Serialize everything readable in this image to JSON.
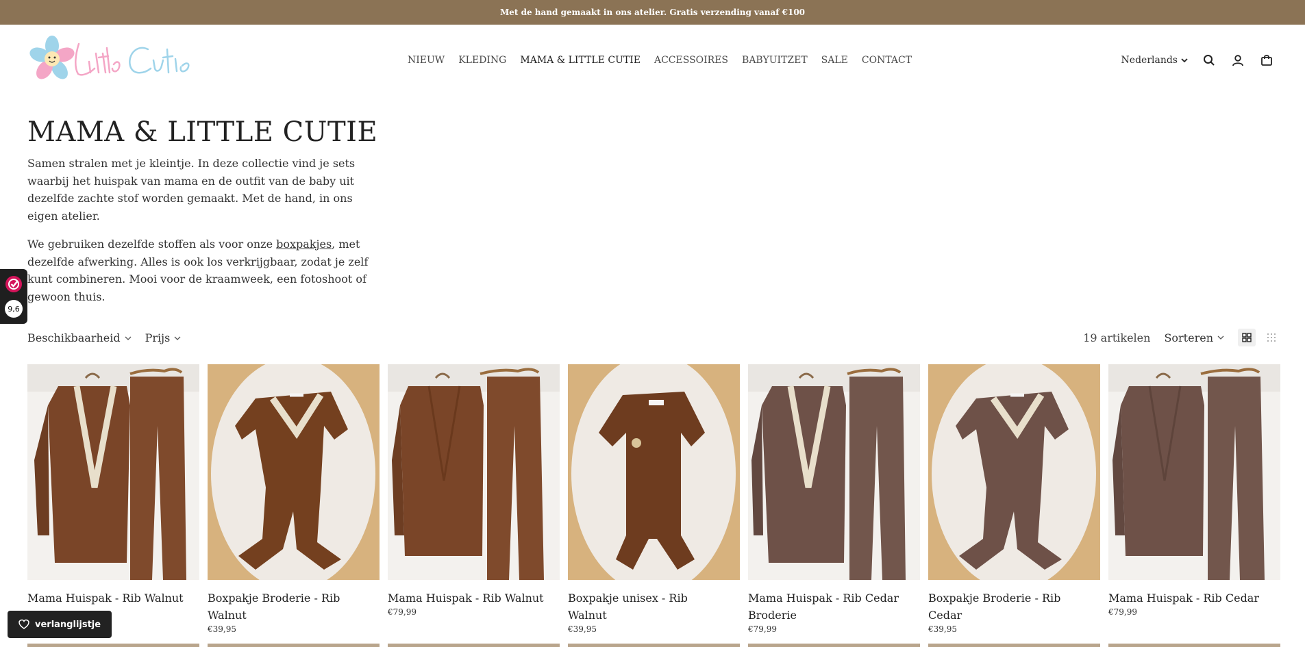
{
  "announcement": "Met de hand gemaakt in ons atelier. Gratis verzending vanaf €100",
  "nav": [
    {
      "label": "NIEUW"
    },
    {
      "label": "KLEDING"
    },
    {
      "label": "MAMA & LITTLE CUTIE"
    },
    {
      "label": "ACCESSOIRES"
    },
    {
      "label": "BABYUITZET"
    },
    {
      "label": "SALE"
    },
    {
      "label": "CONTACT"
    }
  ],
  "header": {
    "language": "Nederlands"
  },
  "page": {
    "title": "MAMA & LITTLE CUTIE",
    "desc1": "Samen stralen met je kleintje. In deze collectie vind je sets waarbij het huispak van mama en de outfit van de baby uit dezelfde zachte stof worden gemaakt. Met de hand, in ons eigen atelier.",
    "desc2_before": "We gebruiken dezelfde stoffen als voor onze ",
    "desc2_link": "boxpakjes",
    "desc2_after": ", met dezelfde afwerking. Alles is ook los verkrijgbaar, zodat je zelf kunt combineren. Mooi voor de kraamweek, een fotoshoot of gewoon thuis."
  },
  "review": {
    "score": "9,6"
  },
  "filters": {
    "availability": "Beschikbaarheid",
    "price": "Prijs"
  },
  "toolbar": {
    "count": "19 artikelen",
    "sort": "Sorteren"
  },
  "products": [
    {
      "title": "Mama Huispak - Rib Walnut Broderie",
      "price": ""
    },
    {
      "title": "Boxpakje Broderie - Rib Walnut",
      "price": "€39,95"
    },
    {
      "title": "Mama Huispak - Rib Walnut",
      "price": "€79,99"
    },
    {
      "title": "Boxpakje unisex - Rib Walnut",
      "price": "€39,95"
    },
    {
      "title": "Mama Huispak - Rib Cedar Broderie",
      "price": "€79,99"
    },
    {
      "title": "Boxpakje Broderie - Rib Cedar",
      "price": "€39,95"
    },
    {
      "title": "Mama Huispak - Rib Cedar",
      "price": "€79,99"
    }
  ],
  "wishlist": {
    "label": "verlanglijstje"
  },
  "colors": {
    "announcement": "#8b7355",
    "walnut": "#7a4528",
    "cedar": "#6e5148",
    "logo_pink": "#f4a6c6",
    "logo_blue": "#9fd4ea"
  }
}
